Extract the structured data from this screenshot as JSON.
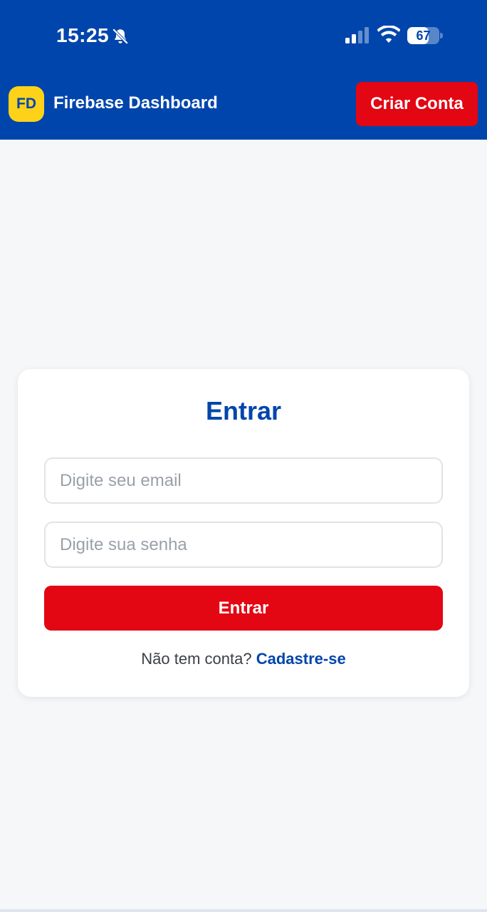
{
  "status_bar": {
    "time": "15:25",
    "battery": "67",
    "battery_level": 0.67
  },
  "header": {
    "logo_text": "FD",
    "title": "Firebase Dashboard",
    "signup_button": "Criar Conta"
  },
  "login": {
    "title": "Entrar",
    "email_placeholder": "Digite seu email",
    "email_value": "",
    "password_placeholder": "Digite sua senha",
    "password_value": "",
    "submit_label": "Entrar",
    "no_account_text": "Não tem conta?",
    "register_link": "Cadastre-se"
  },
  "colors": {
    "primary_blue": "#0045ac",
    "accent_red": "#e30613",
    "logo_yellow": "#ffd21a",
    "background": "#f6f7f9"
  },
  "icons": [
    "bell-slash-icon",
    "cellular-signal-icon",
    "wifi-icon",
    "battery-icon"
  ]
}
